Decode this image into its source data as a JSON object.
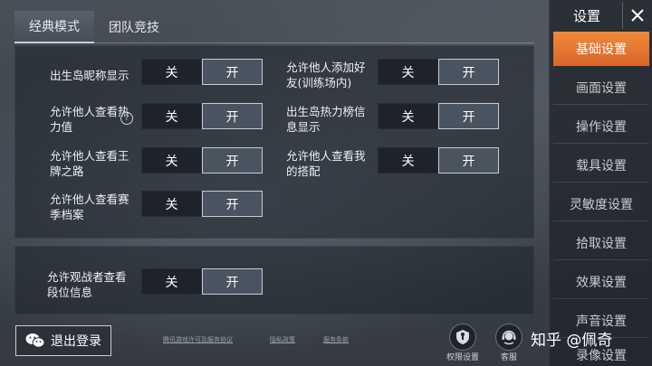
{
  "tabs": [
    {
      "label": "经典模式"
    },
    {
      "label": "团队竞技"
    }
  ],
  "toggle": {
    "off": "关",
    "on": "开"
  },
  "settings": [
    {
      "label": "出生岛昵称显示"
    },
    {
      "label": "允许他人查看热力值"
    },
    {
      "label": "允许他人查看王牌之路"
    },
    {
      "label": "允许他人查看赛季档案"
    },
    {
      "label": "允许他人添加好友(训练场内)"
    },
    {
      "label": "出生岛热力榜信息显示"
    },
    {
      "label": "允许他人查看我的搭配"
    },
    {
      "label": "允许观战者查看段位信息"
    }
  ],
  "help_glyph": "?",
  "footer": {
    "logout": "退出登录",
    "links": [
      "腾讯游戏许可及服务协议",
      "隐私政策",
      "服务条款"
    ],
    "permission": "权限设置",
    "service": "客服"
  },
  "watermark": "知乎 @佩奇",
  "sidebar": {
    "title": "设置",
    "items": [
      {
        "label": "基础设置"
      },
      {
        "label": "画面设置"
      },
      {
        "label": "操作设置"
      },
      {
        "label": "载具设置"
      },
      {
        "label": "灵敏度设置"
      },
      {
        "label": "拾取设置"
      },
      {
        "label": "效果设置"
      },
      {
        "label": "声音设置"
      },
      {
        "label": "录像设置"
      }
    ]
  },
  "colors": {
    "accent": "#e8772f",
    "toggle_on": "#4a5360",
    "toggle_off": "#1d222b"
  }
}
